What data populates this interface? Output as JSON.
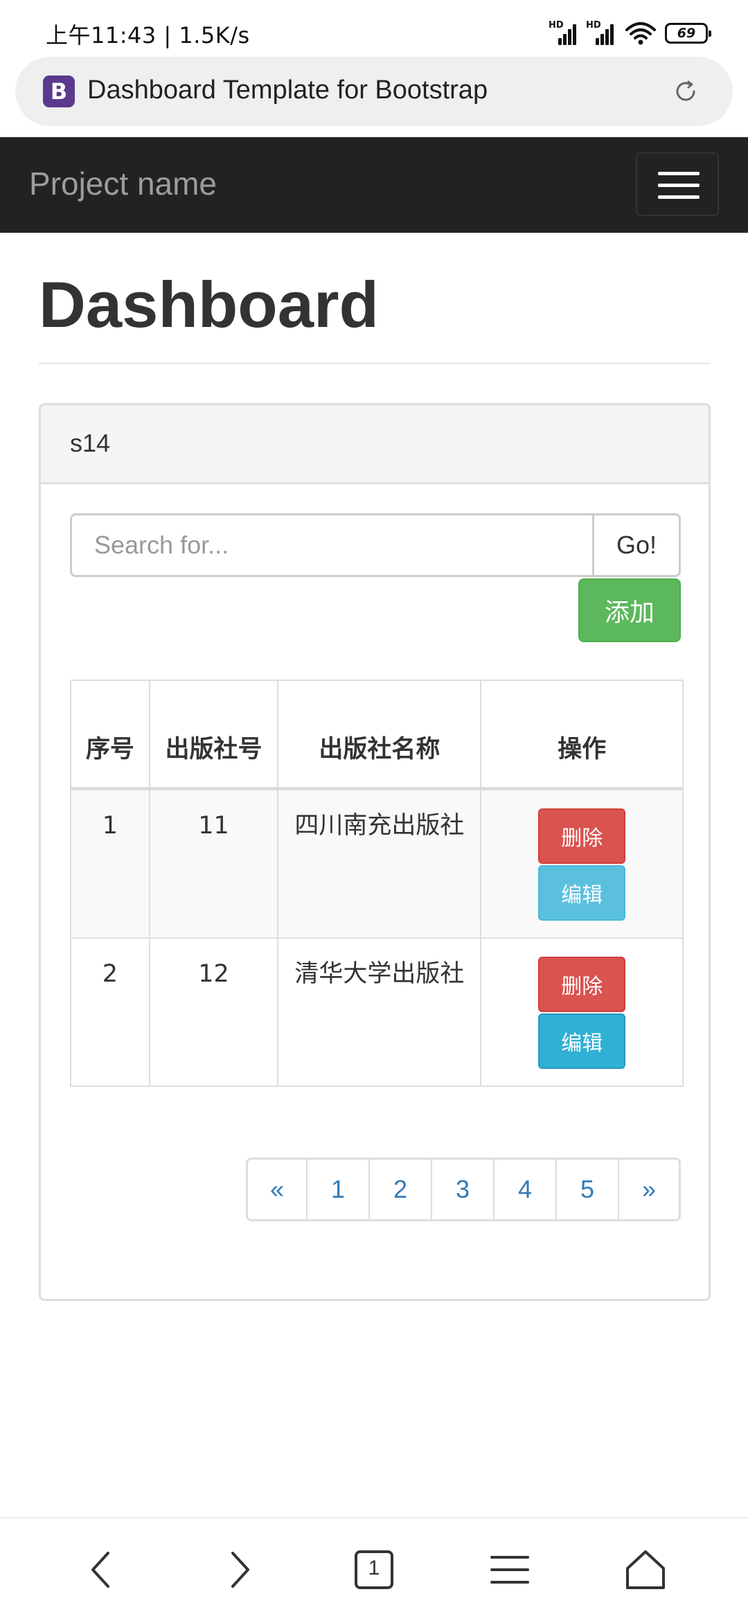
{
  "status_bar": {
    "time": "上午11:43 | 1.5K/s",
    "signal_1_label": "HD",
    "signal_2_label": "HD",
    "battery_level": "69",
    "icons": [
      "signal-icon",
      "signal-icon",
      "wifi-icon",
      "battery-icon"
    ]
  },
  "browser": {
    "tab_title": "Dashboard Template for Bootstrap",
    "favicon_letter": "B",
    "favicon_color": "#5b3a8e",
    "tab_count": "1"
  },
  "navbar": {
    "brand": "Project name",
    "background": "#222222"
  },
  "page": {
    "title": "Dashboard"
  },
  "panel": {
    "title": "s14",
    "search": {
      "placeholder": "Search for...",
      "value": "",
      "button_label": "Go!"
    },
    "add_button_label": "添加",
    "table": {
      "headers": [
        "序号",
        "出版社号",
        "出版社名称",
        "操作"
      ],
      "rows": [
        {
          "index": "1",
          "publisher_id": "11",
          "publisher_name": "四川南充出版社",
          "delete_label": "删除",
          "edit_label": "编辑"
        },
        {
          "index": "2",
          "publisher_id": "12",
          "publisher_name": "清华大学出版社",
          "delete_label": "删除",
          "edit_label": "编辑"
        }
      ]
    },
    "pagination": [
      "«",
      "1",
      "2",
      "3",
      "4",
      "5",
      "»"
    ]
  },
  "colors": {
    "success": "#5cb85c",
    "danger": "#d9534f",
    "info": "#5bc0de",
    "link": "#337ab7"
  }
}
